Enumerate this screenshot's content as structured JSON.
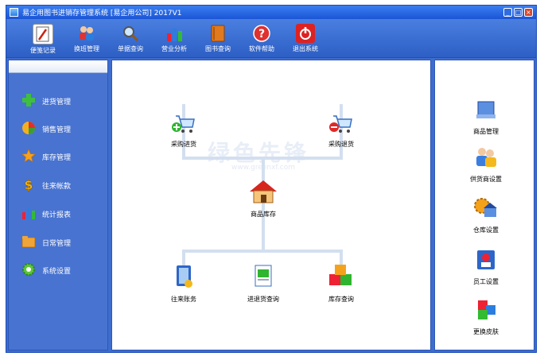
{
  "window": {
    "title": "易企用图书进销存管理系统 [易企用公司] 2017V1"
  },
  "toolbar": {
    "items": [
      {
        "label": "便笺记录",
        "icon": "notepad-icon"
      },
      {
        "label": "换班管理",
        "icon": "users-icon"
      },
      {
        "label": "单据查询",
        "icon": "magnifier-icon"
      },
      {
        "label": "营业分析",
        "icon": "bar-chart-icon"
      },
      {
        "label": "图书查询",
        "icon": "book-icon"
      },
      {
        "label": "软件帮助",
        "icon": "help-icon"
      },
      {
        "label": "退出系统",
        "icon": "power-icon"
      }
    ]
  },
  "sidebar": {
    "items": [
      {
        "label": "进货管理",
        "icon": "plus-icon"
      },
      {
        "label": "销售管理",
        "icon": "pie-chart-icon"
      },
      {
        "label": "库存管理",
        "icon": "star-icon"
      },
      {
        "label": "往来帐款",
        "icon": "dollar-icon"
      },
      {
        "label": "统计报表",
        "icon": "bar-chart-icon"
      },
      {
        "label": "日常管理",
        "icon": "folder-icon"
      },
      {
        "label": "系统设置",
        "icon": "gear-icon"
      }
    ]
  },
  "flow": {
    "purchase": "采购进货",
    "purchase_return": "采购退货",
    "inventory": "商品库存",
    "accounts": "往来账务",
    "io_query": "进退货查询",
    "stock_query": "库存查询"
  },
  "watermark": {
    "main": "绿色先锋",
    "sub": "www.greenxf.com"
  },
  "right_panel": {
    "items": [
      {
        "label": "商品管理",
        "icon": "product-icon"
      },
      {
        "label": "供货商设置",
        "icon": "supplier-icon"
      },
      {
        "label": "仓库设置",
        "icon": "warehouse-icon"
      },
      {
        "label": "员工设置",
        "icon": "staff-icon"
      },
      {
        "label": "更换皮肤",
        "icon": "skin-icon"
      }
    ]
  },
  "colors": {
    "frame": "#3d6dcf",
    "titlebar": "#1b55d6",
    "close": "#d8452b"
  }
}
